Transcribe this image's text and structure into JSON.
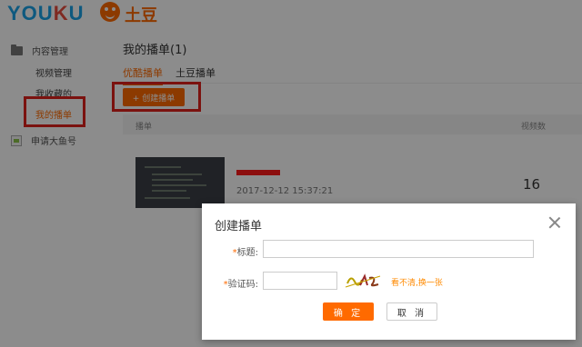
{
  "header": {
    "youku_logo": "YOUKU",
    "tudou_logo": "土豆"
  },
  "sidebar": {
    "group_label": "内容管理",
    "items": [
      {
        "label": "视频管理"
      },
      {
        "label": "我收藏的"
      },
      {
        "label": "我的播单"
      }
    ],
    "apply_label": "申请大鱼号"
  },
  "main": {
    "title": "我的播单(1)",
    "tabs": [
      {
        "label": "优酷播单"
      },
      {
        "label": "土豆播单"
      }
    ],
    "create_button": "+ 创建播单",
    "table": {
      "columns": [
        "播单",
        "视频数"
      ],
      "rows": [
        {
          "date": "2017-12-12 15:37:21",
          "count": "16"
        }
      ]
    }
  },
  "modal": {
    "title": "创建播单",
    "title_label": "标题:",
    "title_value": "",
    "captcha_label": "验证码:",
    "captcha_value": "",
    "captcha_refresh": "看不清,换一张",
    "confirm": "确 定",
    "cancel": "取 消"
  },
  "colors": {
    "accent": "#ff6a00",
    "highlight_box": "#e0211c",
    "youku_blue": "#1aa3e8"
  }
}
